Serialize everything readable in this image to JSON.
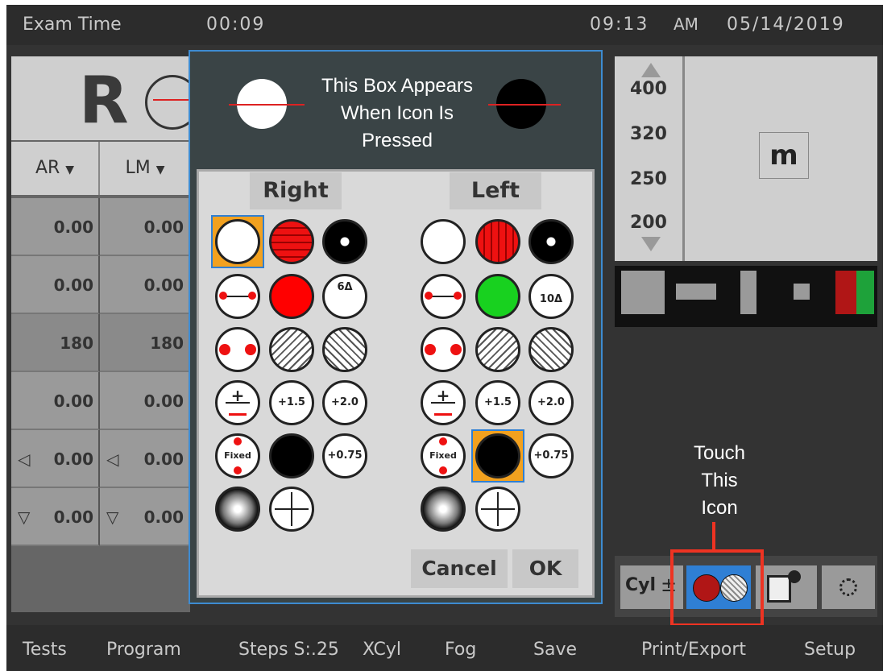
{
  "topbar": {
    "exam_label": "Exam Time",
    "exam_time": "00:09",
    "clock": "09:13",
    "ampm": "AM",
    "date": "05/14/2019"
  },
  "left_panel": {
    "eye": "R",
    "columns": [
      "AR",
      "LM"
    ],
    "rows": [
      {
        "ar": "0.00",
        "lm": "0.00"
      },
      {
        "ar": "0.00",
        "lm": "0.00"
      },
      {
        "ar": "180",
        "lm": "180"
      },
      {
        "ar": "0.00",
        "lm": "0.00"
      },
      {
        "ar": "0.00",
        "lm": "0.00",
        "marker": "◁"
      },
      {
        "ar": "0.00",
        "lm": "0.00",
        "marker": "▽"
      }
    ]
  },
  "modal": {
    "note": [
      "This Box Appears",
      "When Icon Is",
      "Pressed"
    ],
    "right_label": "Right",
    "left_label": "Left",
    "icon_labels": {
      "prism6": "6Δ",
      "prism10": "10Δ",
      "plus15": "+1.5",
      "plus20": "+2.0",
      "plus075": "+0.75",
      "fixed": "Fixed"
    },
    "cancel": "Cancel",
    "ok": "OK"
  },
  "right_panel": {
    "scale": [
      "400",
      "320",
      "250",
      "200"
    ],
    "target_letter": "m",
    "annotation": [
      "Touch",
      "This",
      "Icon"
    ],
    "icon_buttons": [
      "cyl-plus-minus-icon",
      "occluder-selector-icon",
      "export-icon",
      "brightness-icon"
    ],
    "cyl_label": "Cyl"
  },
  "bottom_menu": [
    "Tests",
    "Program",
    "Steps S:.25",
    "XCyl",
    "Fog",
    "Save",
    "Print/Export",
    "Setup"
  ],
  "colors": {
    "accent_blue": "#2f7fd4",
    "highlight_red": "#e32222",
    "selection_orange": "#f2a11f"
  }
}
